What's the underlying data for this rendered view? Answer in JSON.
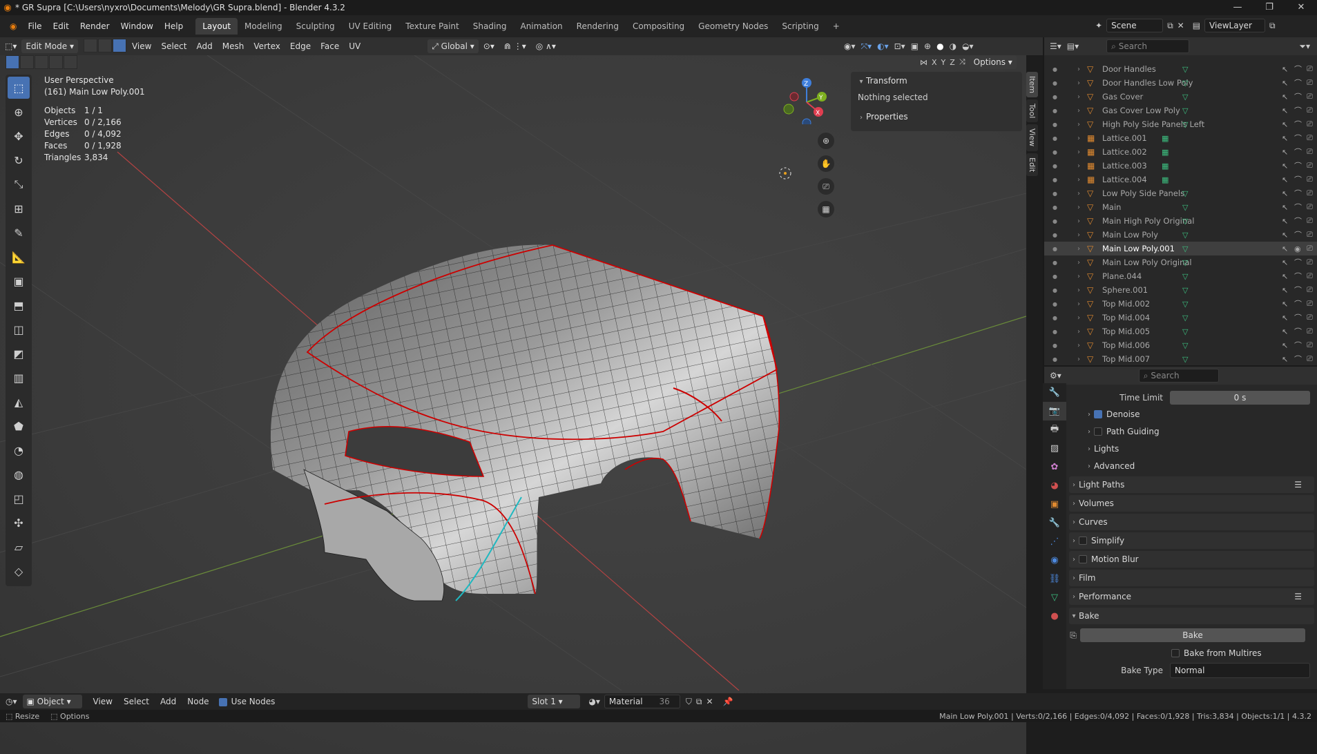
{
  "window": {
    "title": "* GR Supra [C:\\Users\\nyxro\\Documents\\Melody\\GR Supra.blend] - Blender 4.3.2",
    "controls": [
      "—",
      "❐",
      "✕"
    ]
  },
  "menu": [
    "File",
    "Edit",
    "Render",
    "Window",
    "Help"
  ],
  "workspaces": [
    "Layout",
    "Modeling",
    "Sculpting",
    "UV Editing",
    "Texture Paint",
    "Shading",
    "Animation",
    "Rendering",
    "Compositing",
    "Geometry Nodes",
    "Scripting"
  ],
  "active_workspace": "Layout",
  "scene": {
    "name": "Scene",
    "view_layer": "ViewLayer"
  },
  "viewport_header": {
    "mode": "Edit Mode",
    "menus": [
      "View",
      "Select",
      "Add",
      "Mesh",
      "Vertex",
      "Edge",
      "Face",
      "UV"
    ],
    "orientation": "Global",
    "options": "Options",
    "axes": [
      "X",
      "Y",
      "Z"
    ]
  },
  "overlay": {
    "perspective": "User Perspective",
    "object": "(161) Main Low Poly.001",
    "stats": [
      {
        "label": "Objects",
        "value": "1 / 1"
      },
      {
        "label": "Vertices",
        "value": "0 / 2,166"
      },
      {
        "label": "Edges",
        "value": "0 / 4,092"
      },
      {
        "label": "Faces",
        "value": "0 / 1,928"
      },
      {
        "label": "Triangles",
        "value": "3,834"
      }
    ]
  },
  "npanel": {
    "transform": "Transform",
    "nothing": "Nothing selected",
    "properties": "Properties",
    "tabs": [
      "Item",
      "Tool",
      "View",
      "Edit"
    ]
  },
  "gizmo": {
    "x": "X",
    "y": "Y",
    "z": "Z"
  },
  "outliner": {
    "search_placeholder": "Search",
    "items": [
      {
        "name": "Door Handles",
        "type": "mesh"
      },
      {
        "name": "Door Handles Low Poly",
        "type": "mesh"
      },
      {
        "name": "Gas Cover",
        "type": "mesh"
      },
      {
        "name": "Gas Cover Low Poly",
        "type": "mesh"
      },
      {
        "name": "High Poly Side Panels Left",
        "type": "mesh"
      },
      {
        "name": "Lattice.001",
        "type": "lattice"
      },
      {
        "name": "Lattice.002",
        "type": "lattice"
      },
      {
        "name": "Lattice.003",
        "type": "lattice"
      },
      {
        "name": "Lattice.004",
        "type": "lattice"
      },
      {
        "name": "Low Poly Side Panels",
        "type": "mesh"
      },
      {
        "name": "Main",
        "type": "mesh"
      },
      {
        "name": "Main High Poly Original",
        "type": "mesh"
      },
      {
        "name": "Main Low Poly",
        "type": "mesh"
      },
      {
        "name": "Main Low Poly.001",
        "type": "mesh",
        "selected": true
      },
      {
        "name": "Main Low Poly Original",
        "type": "mesh"
      },
      {
        "name": "Plane.044",
        "type": "mesh"
      },
      {
        "name": "Sphere.001",
        "type": "mesh"
      },
      {
        "name": "Top Mid.002",
        "type": "mesh"
      },
      {
        "name": "Top Mid.004",
        "type": "mesh"
      },
      {
        "name": "Top Mid.005",
        "type": "mesh"
      },
      {
        "name": "Top Mid.006",
        "type": "mesh"
      },
      {
        "name": "Top Mid.007",
        "type": "mesh"
      }
    ]
  },
  "properties": {
    "search_placeholder": "Search",
    "time_limit_label": "Time Limit",
    "time_limit_value": "0 s",
    "subpanels": [
      {
        "label": "Denoise",
        "checked": true
      },
      {
        "label": "Path Guiding",
        "checked": false
      },
      {
        "label": "Lights"
      },
      {
        "label": "Advanced"
      }
    ],
    "panels": [
      {
        "label": "Light Paths",
        "list": true
      },
      {
        "label": "Volumes"
      },
      {
        "label": "Curves"
      },
      {
        "label": "Simplify",
        "checkbox": true
      },
      {
        "label": "Motion Blur",
        "checkbox": true
      },
      {
        "label": "Film"
      },
      {
        "label": "Performance",
        "list": true
      }
    ],
    "bake": {
      "label": "Bake",
      "button": "Bake",
      "from_multires": "Bake from Multires",
      "type_label": "Bake Type",
      "type_value": "Normal"
    }
  },
  "bottom": {
    "mode": "Object",
    "menus": [
      "View",
      "Select",
      "Add",
      "Node"
    ],
    "use_nodes": "Use Nodes",
    "slot": "Slot 1",
    "material": "Material",
    "users": "36"
  },
  "status": {
    "left": [
      "Resize",
      "Options"
    ],
    "right": "Main Low Poly.001 | Verts:0/2,166 | Edges:0/4,092 | Faces:0/1,928 | Tris:3,834 | Objects:1/1 | 4.3.2"
  }
}
